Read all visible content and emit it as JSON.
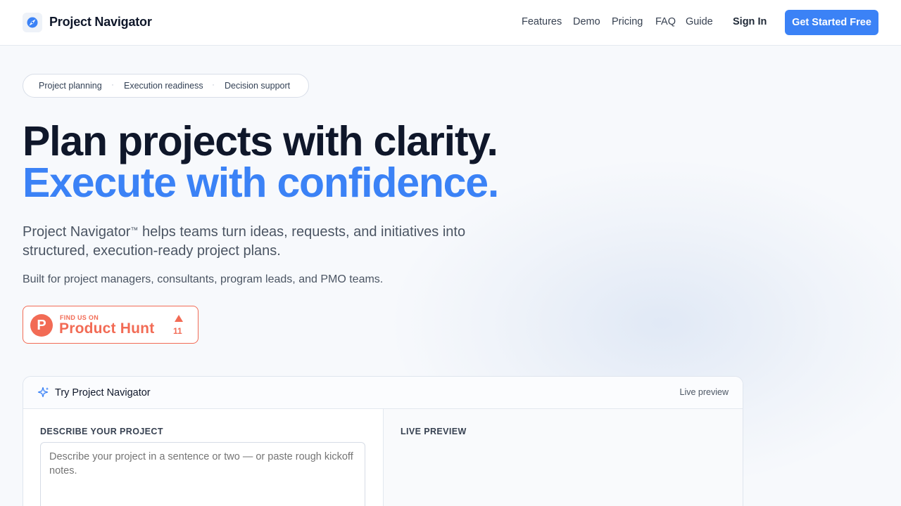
{
  "header": {
    "brand": "Project Navigator",
    "nav": [
      "Features",
      "Demo",
      "Pricing",
      "FAQ",
      "Guide"
    ],
    "sign_in": "Sign In",
    "cta": "Get Started Free"
  },
  "hero": {
    "pills": [
      "Project planning",
      "Execution readiness",
      "Decision support"
    ],
    "headline_line1": "Plan projects with clarity.",
    "headline_line2": "Execute with confidence.",
    "lead_brand": "Project Navigator",
    "lead_tm": "™",
    "lead_rest": " helps teams turn ideas, requests, and initiatives into structured, execution-ready project plans.",
    "sub": "Built for project managers, consultants, program leads, and PMO teams."
  },
  "product_hunt": {
    "find_us": "FIND US ON",
    "name": "Product Hunt",
    "letter": "P",
    "upvotes": "11"
  },
  "try_panel": {
    "title": "Try Project Navigator",
    "live_badge": "Live preview",
    "left_label": "DESCRIBE YOUR PROJECT",
    "placeholder": "Describe your project in a sentence or two — or paste rough kickoff notes.",
    "right_label": "LIVE PREVIEW"
  },
  "colors": {
    "accent": "#3b82f6",
    "product_hunt": "#f26b55",
    "heading": "#0f172a"
  },
  "icons": {
    "logo": "compass-navigation-icon",
    "panel": "sparkle-icon",
    "product_hunt": "product-hunt-logo",
    "upvote": "upvote-triangle-icon"
  }
}
